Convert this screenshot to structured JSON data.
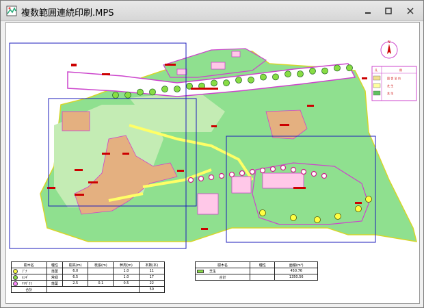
{
  "window": {
    "title": "複数範囲連続印刷.MPS",
    "icons": {
      "app": "map-app-icon",
      "minimize": "minimize-icon",
      "maximize": "maximize-icon",
      "close": "close-icon"
    }
  },
  "colors": {
    "grass": "#8fe08f",
    "lawn_light": "#c4ecb4",
    "building": "#e4b080",
    "pink_building": "#ffc8e8",
    "road": "#ffffff",
    "outline_pink": "#cc44cc",
    "tree": "#99dd55",
    "print_frame": "#1b1bbb",
    "label_red": "#cc0000",
    "yellow_path": "#ffff66"
  },
  "map": {
    "compass": "compass-north-icon",
    "legend_box": {
      "header": [
        "凡",
        "例"
      ],
      "rows": [
        {
          "swatch": "#f2e090",
          "label": "園 舎 法 内"
        },
        {
          "swatch": "#ffffa0",
          "label": "芝 生"
        },
        {
          "swatch": "#60c060",
          "label": "芝 生"
        }
      ]
    },
    "print_ranges": 3
  },
  "tree_table": {
    "headers": [
      "樹木名",
      "種性",
      "樹高(m)",
      "枝張(m)",
      "幹周(m)",
      "本数(本)"
    ],
    "rows": [
      {
        "icon_color": "#ffff44",
        "name": "ﾌﾞﾅ",
        "type": "落葉",
        "height": "6.0",
        "spread": "",
        "girth": "1.0",
        "count": "11"
      },
      {
        "icon_color": "#88dd44",
        "name": "ﾎﾝｷﾞ",
        "type": "常緑",
        "height": "6.5",
        "spread": "",
        "girth": "1.0",
        "count": "17"
      },
      {
        "icon_color": "#ff88ff",
        "name": "ﾔﾏｻﾞｸﾗ",
        "type": "落葉",
        "height": "2.5",
        "spread": "0.1",
        "girth": "0.5",
        "count": "22"
      }
    ],
    "total_label": "合計",
    "total_count": "50"
  },
  "area_table": {
    "headers": [
      "樹木名",
      "種性",
      "面積(m²)"
    ],
    "rows": [
      {
        "icon_color": "#88dd44",
        "name": "芝生",
        "type": "",
        "area": "450.76"
      }
    ],
    "total_label": "合計",
    "total_area": "1350.56"
  }
}
